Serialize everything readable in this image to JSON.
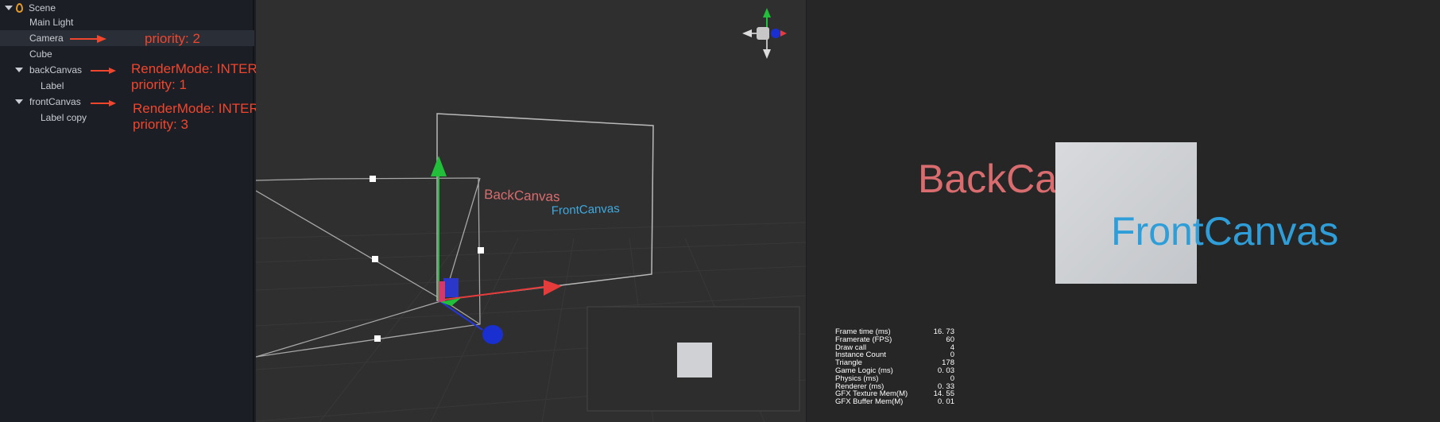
{
  "hierarchy": {
    "root": "Scene",
    "items": [
      {
        "label": "Main Light"
      },
      {
        "label": "Camera"
      },
      {
        "label": "Cube"
      },
      {
        "label": "backCanvas"
      },
      {
        "label": "Label"
      },
      {
        "label": "frontCanvas"
      },
      {
        "label": "Label copy"
      }
    ]
  },
  "annotations": {
    "camera": "priority: 2",
    "back_mode": "RenderMode: INTERSPERSE",
    "back_priority": "priority: 1",
    "front_mode": "RenderMode: INTERSPERSE",
    "front_priority": "priority: 3"
  },
  "scene": {
    "back_label": "BackCanvas",
    "front_label": "FrontCanvas",
    "gizmo_icon": "orientation-gizmo-icon"
  },
  "game": {
    "back_text": "BackCanvas",
    "front_text": "FrontCanvas",
    "stats": [
      {
        "label": "Frame time (ms)",
        "value": "16. 73"
      },
      {
        "label": "Framerate (FPS)",
        "value": "60"
      },
      {
        "label": "Draw call",
        "value": "4"
      },
      {
        "label": "Instance Count",
        "value": "0"
      },
      {
        "label": "Triangle",
        "value": "178"
      },
      {
        "label": "Game Logic (ms)",
        "value": "0. 03"
      },
      {
        "label": "Physics (ms)",
        "value": "0"
      },
      {
        "label": "Renderer (ms)",
        "value": "0. 33"
      },
      {
        "label": "GFX Texture Mem(M)",
        "value": "14. 55"
      },
      {
        "label": "GFX Buffer Mem(M)",
        "value": "0. 01"
      }
    ]
  },
  "colors": {
    "annotation": "#f0462e",
    "back_text": "#d96c6e",
    "front_text": "#2f9ed8"
  }
}
